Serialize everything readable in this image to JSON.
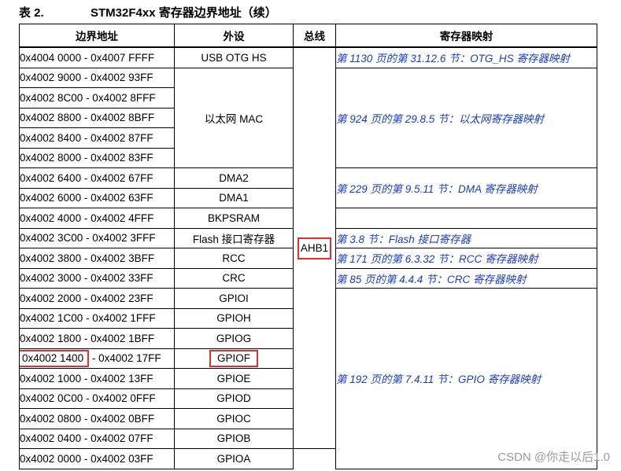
{
  "caption": {
    "label": "表 2.",
    "title": "STM32F4xx 寄存器边界地址（续）"
  },
  "headers": [
    "边界地址",
    "外设",
    "总线",
    "寄存器映射"
  ],
  "bus": "AHB1",
  "addresses": [
    "0x4004 0000 - 0x4007 FFFF",
    "0x4002 9000 - 0x4002 93FF",
    "0x4002 8C00 - 0x4002 8FFF",
    "0x4002 8800 - 0x4002 8BFF",
    "0x4002 8400 - 0x4002 87FF",
    "0x4002 8000 - 0x4002 83FF",
    "0x4002 6400 - 0x4002 67FF",
    "0x4002 6000 - 0x4002 63FF",
    "0x4002 4000 - 0x4002 4FFF",
    "0x4002 3C00 - 0x4002 3FFF",
    "0x4002 3800 - 0x4002 3BFF",
    "0x4002 3000 - 0x4002 33FF",
    "0x4002 2000 - 0x4002 23FF",
    "0x4002 1C00 - 0x4002 1FFF",
    "0x4002 1800 - 0x4002 1BFF",
    "0x4002 1000 - 0x4002 13FF",
    "0x4002 0C00 - 0x4002 0FFF",
    "0x4002 0800 - 0x4002 0BFF",
    "0x4002 0400 - 0x4002 07FF",
    "0x4002 0000 - 0x4002 03FF"
  ],
  "highlight_address": {
    "start": "0x4002 1400",
    "rest": " - 0x4002 17FF"
  },
  "peripherals": {
    "usb_otg_hs": "USB OTG HS",
    "ethernet_mac": "以太网 MAC",
    "dma2": "DMA2",
    "dma1": "DMA1",
    "bkpsram": "BKPSRAM",
    "flash": "Flash 接口寄存器",
    "rcc": "RCC",
    "crc": "CRC",
    "gpioi": "GPIOI",
    "gpioh": "GPIOH",
    "gpiog": "GPIOG",
    "gpiof": "GPIOF",
    "gpioe": "GPIOE",
    "gpiod": "GPIOD",
    "gpioc": "GPIOC",
    "gpiob": "GPIOB",
    "gpioa": "GPIOA"
  },
  "register_maps": {
    "otg_hs": "第 1130 页的第 31.12.6 节：OTG_HS 寄存器映射",
    "ethernet": "第 924 页的第 29.8.5 节：以太网寄存器映射",
    "dma": "第 229 页的第 9.5.11 节：DMA 寄存器映射",
    "flash": "第 3.8 节：Flash 接口寄存器",
    "rcc": "第 171 页的第 6.3.32 节：RCC 寄存器映射",
    "crc": "第 85 页的第 4.4.4 节：CRC 寄存器映射",
    "gpio": "第 192 页的第 7.4.11 节：GPIO 寄存器映射"
  },
  "watermark": "CSDN @你走以后1.0",
  "colors": {
    "link": "#1a3ccc",
    "highlight": "#e03030",
    "watermark": "#9a9a9a"
  }
}
